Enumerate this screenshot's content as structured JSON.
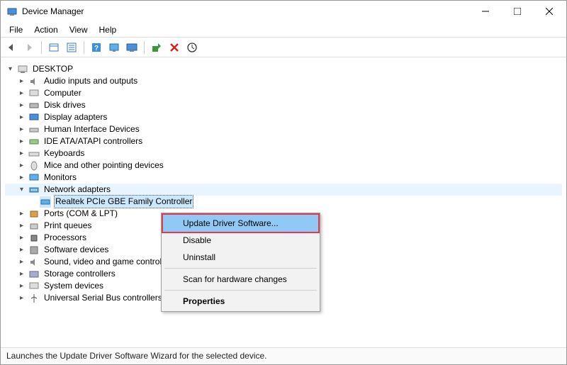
{
  "window": {
    "title": "Device Manager"
  },
  "menu": {
    "file": "File",
    "action": "Action",
    "view": "View",
    "help": "Help"
  },
  "tree": {
    "root": "DESKTOP",
    "items": [
      "Audio inputs and outputs",
      "Computer",
      "Disk drives",
      "Display adapters",
      "Human Interface Devices",
      "IDE ATA/ATAPI controllers",
      "Keyboards",
      "Mice and other pointing devices",
      "Monitors",
      "Network adapters",
      "Ports (COM & LPT)",
      "Print queues",
      "Processors",
      "Software devices",
      "Sound, video and game controllers",
      "Storage controllers",
      "System devices",
      "Universal Serial Bus controllers"
    ],
    "network_child": "Realtek PCIe GBE Family Controller"
  },
  "context_menu": {
    "update": "Update Driver Software...",
    "disable": "Disable",
    "uninstall": "Uninstall",
    "scan": "Scan for hardware changes",
    "properties": "Properties"
  },
  "status": "Launches the Update Driver Software Wizard for the selected device.",
  "icons": {
    "app": "device-manager-icon",
    "back": "back-icon",
    "fwd": "forward-icon",
    "show": "show-hidden-icon",
    "prop": "properties-icon",
    "help": "help-icon",
    "scan": "scan-hardware-icon",
    "monitor": "monitor-icon",
    "update": "update-driver-icon",
    "remove": "uninstall-icon",
    "down": "down-icon"
  }
}
